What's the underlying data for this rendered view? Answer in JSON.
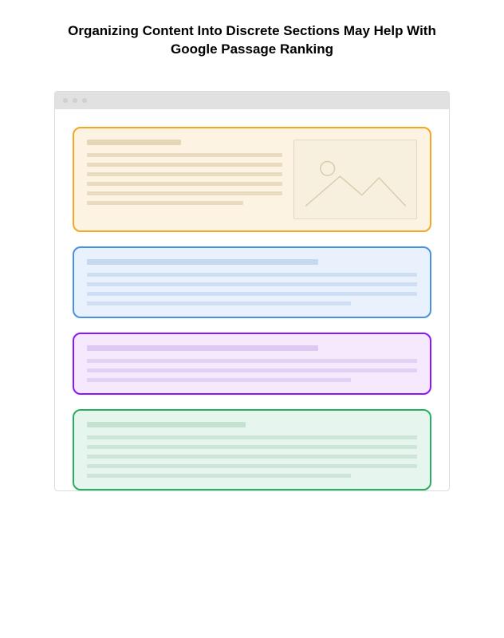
{
  "headline": "Organizing Content Into Discrete Sections May Help With Google Passage Ranking",
  "sections": [
    {
      "name": "section-1",
      "color": "orange",
      "has_image": true
    },
    {
      "name": "section-2",
      "color": "blue",
      "has_image": false
    },
    {
      "name": "section-3",
      "color": "purple",
      "has_image": false
    },
    {
      "name": "section-4",
      "color": "green",
      "has_image": false
    }
  ],
  "colors": {
    "orange": "#f5a623",
    "blue": "#4a90e2",
    "purple": "#9013fe",
    "green": "#27ae60"
  }
}
